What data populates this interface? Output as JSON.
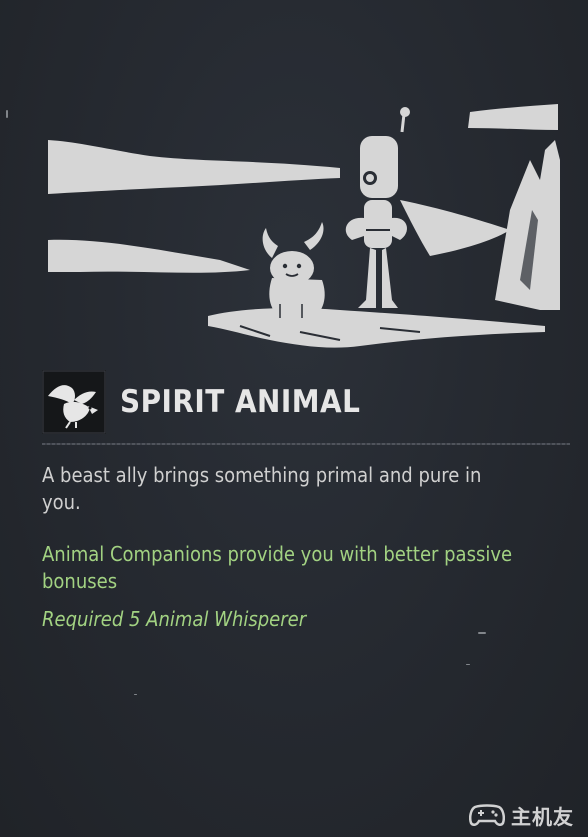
{
  "perk": {
    "title": "SPIRIT ANIMAL",
    "icon": "eagle-icon",
    "description": "A beast ally brings something primal and pure in you.",
    "bonus": "Animal Companions provide you with better passive bonuses",
    "requirement": "Required 5 Animal Whisperer"
  },
  "illustration": {
    "subject": "horned-beast-and-robot-on-cliff"
  },
  "watermark": {
    "text": "主机友",
    "icon": "gamepad-icon"
  },
  "colors": {
    "background": "#24282f",
    "title": "#e6e6e6",
    "description": "#d0d0d0",
    "bonus": "#a2d282",
    "art": "#d6d6d6"
  }
}
